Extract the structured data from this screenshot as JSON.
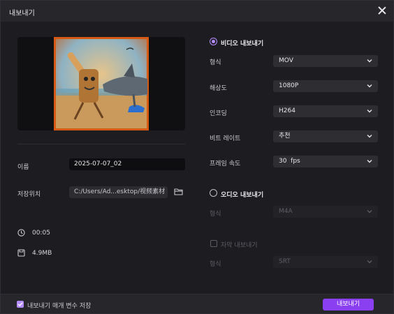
{
  "dialog": {
    "title": "내보내기"
  },
  "left": {
    "name_label": "이름",
    "name_value": "2025-07-07_02",
    "save_label": "저장위치",
    "save_path": "C:/Users/Ad...esktop/视频素材",
    "duration": "00:05",
    "filesize": "4.9MB"
  },
  "video": {
    "section_label": "비디오 내보내기",
    "rows": [
      {
        "label": "형식",
        "value": "MOV"
      },
      {
        "label": "해상도",
        "value": "1080P"
      },
      {
        "label": "인코딩",
        "value": "H264"
      },
      {
        "label": "비트 레이트",
        "value": "추천"
      },
      {
        "label": "프레임 속도",
        "value": "30  fps"
      }
    ]
  },
  "audio": {
    "section_label": "오디오 내보내기",
    "format_label": "형식",
    "format_value": "M4A"
  },
  "subtitle": {
    "checkbox_label": "자막 내보내기",
    "format_label": "형식",
    "format_value": "SRT"
  },
  "footer": {
    "remember_label": "내보내기 매개 변수 저장",
    "export_button": "내보내기"
  },
  "colors": {
    "accent": "#8a3ff0",
    "radio_accent": "#b58cff"
  }
}
